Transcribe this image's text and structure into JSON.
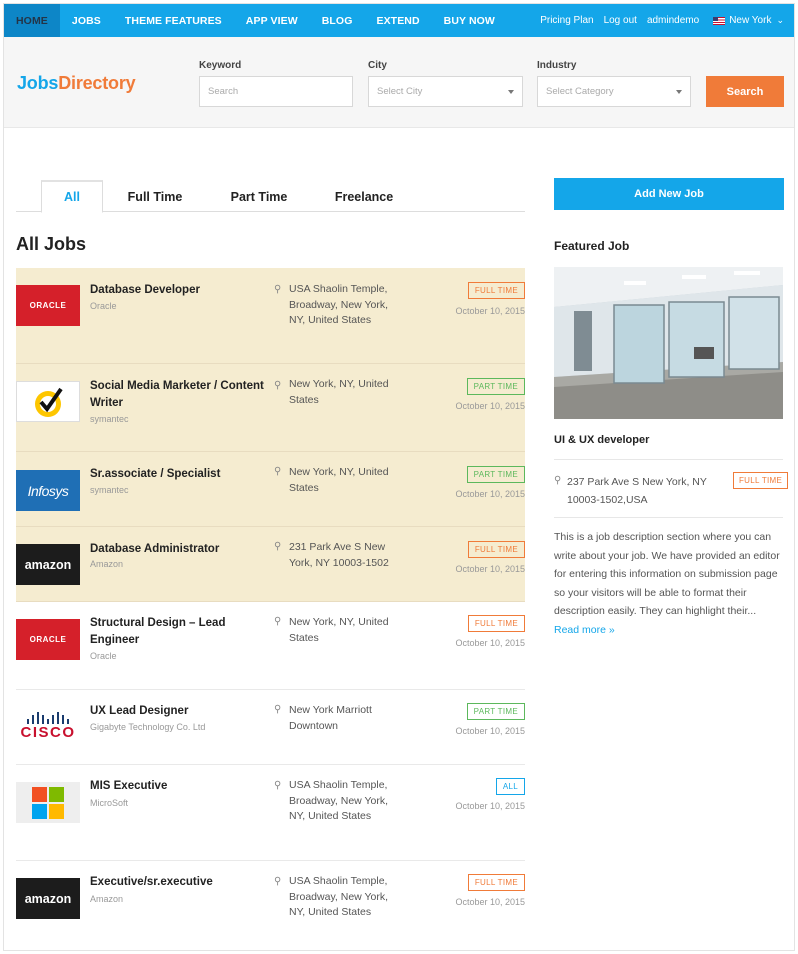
{
  "nav": {
    "items": [
      "HOME",
      "JOBS",
      "THEME FEATURES",
      "APP VIEW",
      "BLOG",
      "EXTEND",
      "BUY NOW"
    ],
    "right": {
      "pricing": "Pricing Plan",
      "logout": "Log out",
      "user": "admindemo",
      "location": "New York"
    }
  },
  "header": {
    "logo_part1": "Jobs",
    "logo_part2": "Directory",
    "keyword_label": "Keyword",
    "keyword_placeholder": "Search",
    "city_label": "City",
    "city_placeholder": "Select City",
    "industry_label": "Industry",
    "industry_placeholder": "Select Category",
    "search_button": "Search"
  },
  "tabs": [
    "All",
    "Full Time",
    "Part Time",
    "Freelance"
  ],
  "section_title": "All Jobs",
  "jobs": [
    {
      "title": "Database Developer",
      "company": "Oracle",
      "location": "USA Shaolin Temple, Broadway, New York, NY, United States",
      "type": "FULL TIME",
      "date": "October 10, 2015",
      "logo": "ORACLE"
    },
    {
      "title": "Social Media Marketer / Content Writer",
      "company": "symantec",
      "location": "New York, NY, United States",
      "type": "PART TIME",
      "date": "October 10, 2015",
      "logo": "symantec-check"
    },
    {
      "title": "Sr.associate / Specialist",
      "company": "symantec",
      "location": "New York, NY, United States",
      "type": "PART TIME",
      "date": "October 10, 2015",
      "logo": "Infosys"
    },
    {
      "title": "Database Administrator",
      "company": "Amazon",
      "location": "231 Park Ave S New York, NY 10003-1502",
      "type": "FULL TIME",
      "date": "October 10, 2015",
      "logo": "amazon"
    },
    {
      "title": "Structural Design – Lead Engineer",
      "company": "Oracle",
      "location": "New York, NY, United States",
      "type": "FULL TIME",
      "date": "October 10, 2015",
      "logo": "ORACLE"
    },
    {
      "title": "UX Lead Designer",
      "company": "Gigabyte Technology Co. Ltd",
      "location": "New York Marriott Downtown",
      "type": "PART TIME",
      "date": "October 10, 2015",
      "logo": "CISCO"
    },
    {
      "title": "MIS Executive",
      "company": "MicroSoft",
      "location": "USA Shaolin Temple, Broadway, New York, NY, United States",
      "type": "ALL",
      "date": "October 10, 2015",
      "logo": "microsoft-windows"
    },
    {
      "title": "Executive/sr.executive",
      "company": "Amazon",
      "location": "USA Shaolin Temple, Broadway, New York, NY, United States",
      "type": "FULL TIME",
      "date": "October 10, 2015",
      "logo": "amazon"
    }
  ],
  "sidebar": {
    "add_job": "Add New Job",
    "featured_heading": "Featured Job",
    "featured_title": "UI & UX developer",
    "featured_location": "237 Park Ave S New York, NY 10003-1502,USA",
    "featured_type": "FULL TIME",
    "featured_desc": "This is a job description section where you can write about your job. We have provided an editor for entering this information on submission page so your visitors will be able to format their description easily. They can highlight their...",
    "read_more": "Read more »"
  },
  "colors": {
    "primary": "#14a6e9",
    "accent": "#f07b39",
    "highlight": "#f5ecd0",
    "part_time": "#5cb85c"
  }
}
